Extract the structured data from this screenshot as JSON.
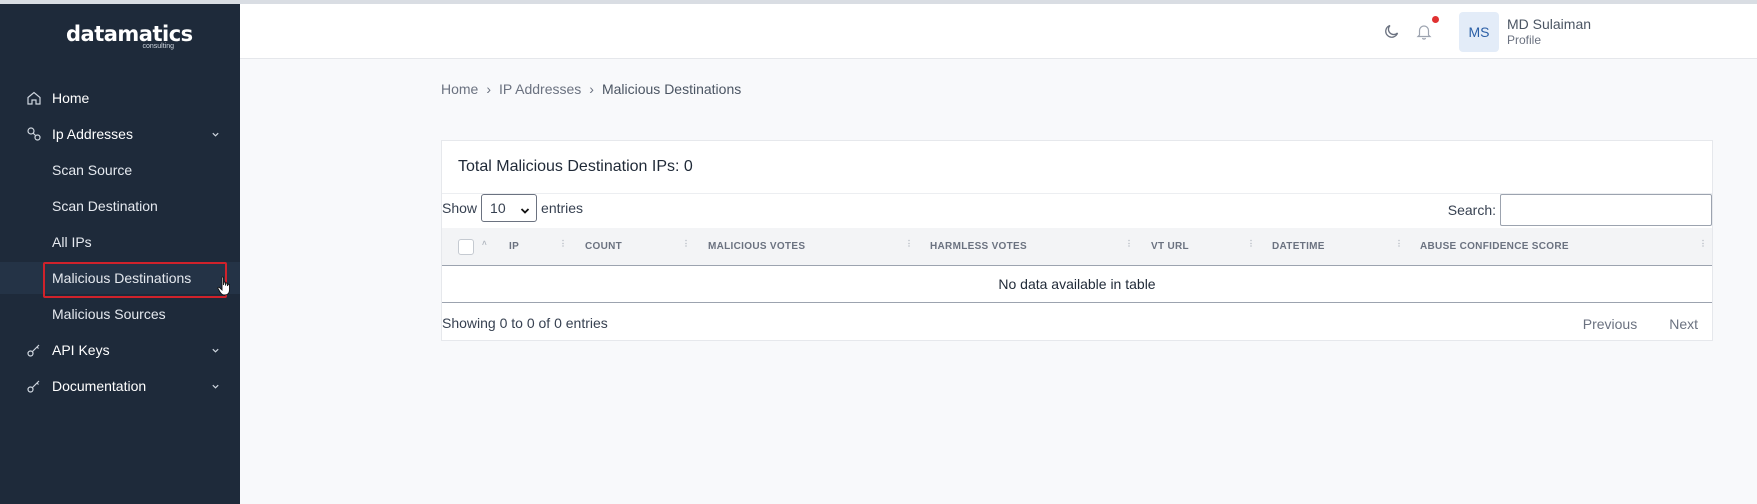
{
  "brand": {
    "name": "datamatics",
    "tagline": "consulting"
  },
  "sidebar": {
    "items": [
      {
        "label": "Home",
        "icon": "home-icon"
      },
      {
        "label": "Ip Addresses",
        "icon": "ip-icon"
      },
      {
        "label": "Scan Source"
      },
      {
        "label": "Scan Destination"
      },
      {
        "label": "All IPs"
      },
      {
        "label": "Malicious Destinations",
        "active": true
      },
      {
        "label": "Malicious Sources"
      },
      {
        "label": "API Keys",
        "icon": "key-icon"
      },
      {
        "label": "Documentation",
        "icon": "key-icon"
      }
    ]
  },
  "header": {
    "user": {
      "initials": "MS",
      "name": "MD Sulaiman",
      "role": "Profile"
    }
  },
  "breadcrumb": [
    "Home",
    "IP Addresses",
    "Malicious Destinations"
  ],
  "breadcrumb_sep": "›",
  "card": {
    "title": "Total Malicious Destination IPs: 0",
    "show_label": "Show",
    "entries_value": "10",
    "entries_label": "entries",
    "search_label": "Search:",
    "columns": [
      "IP",
      "COUNT",
      "MALICIOUS VOTES",
      "HARMLESS VOTES",
      "VT URL",
      "DATETIME",
      "ABUSE CONFIDENCE SCORE"
    ],
    "empty_message": "No data available in table",
    "info": "Showing 0 to 0 of 0 entries",
    "prev_label": "Previous",
    "next_label": "Next"
  },
  "colors": {
    "sidebar": "#1e2a3a",
    "active_outline": "#d0222b",
    "notification": "#e03131"
  }
}
